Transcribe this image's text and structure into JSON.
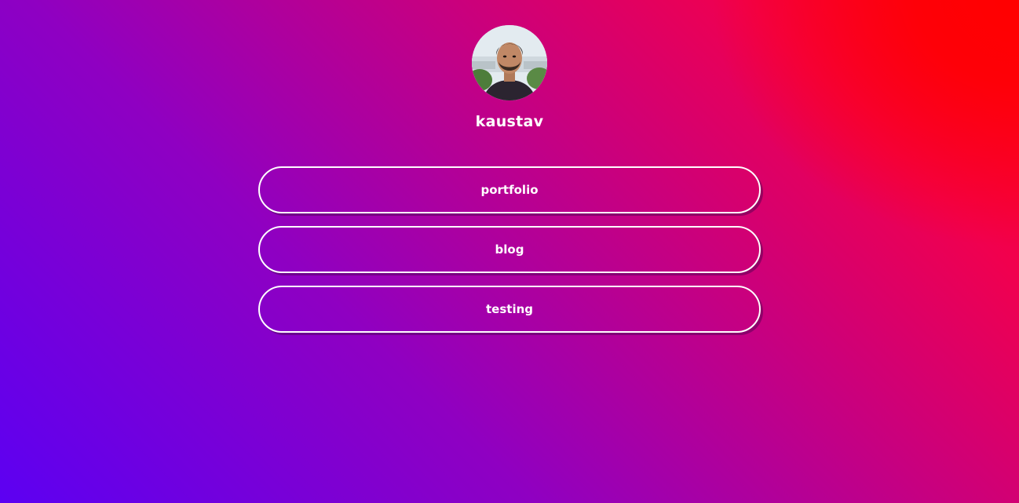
{
  "profile": {
    "username": "kaustav",
    "avatar_icon": "profile-photo"
  },
  "links": [
    {
      "label": "portfolio"
    },
    {
      "label": "blog"
    },
    {
      "label": "testing"
    }
  ],
  "colors": {
    "gradient_start": "#5c00f2",
    "gradient_mid": "#c8007f",
    "gradient_end": "#ff0000",
    "button_border": "#ffffff",
    "text": "#ffffff"
  }
}
